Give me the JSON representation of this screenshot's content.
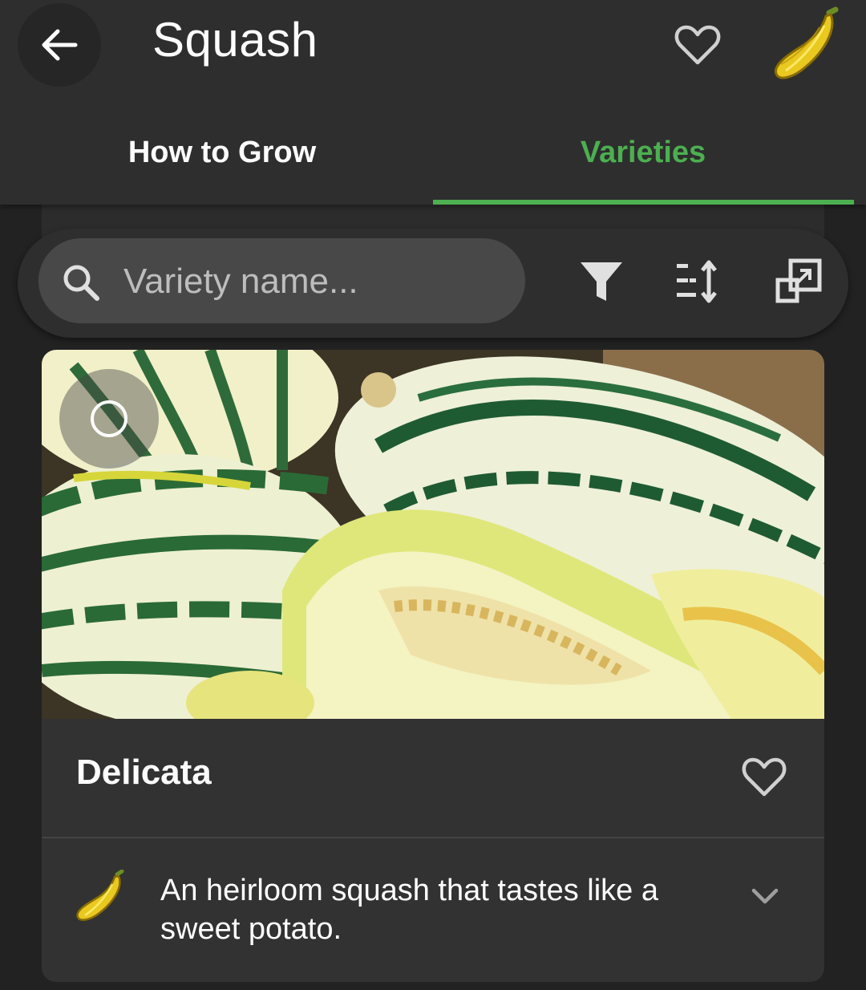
{
  "header": {
    "title": "Squash",
    "back_icon": "arrow-left-icon",
    "favorite_icon": "heart-outline-icon",
    "logo_icon": "squash-icon"
  },
  "tabs": [
    {
      "label": "How to Grow",
      "active": false
    },
    {
      "label": "Varieties",
      "active": true
    }
  ],
  "colors": {
    "accent": "#4caf50",
    "background": "#222222",
    "surface": "#2e2e2e",
    "card": "#323232",
    "search_bg": "#484848"
  },
  "toolbar": {
    "search_placeholder": "Variety name...",
    "search_value": "",
    "icons": [
      "filter-icon",
      "sort-icon",
      "compact-view-icon"
    ]
  },
  "varieties": [
    {
      "name": "Delicata",
      "description": "An heirloom squash that tastes like a sweet potato.",
      "favorite": false,
      "selected": false,
      "expand_icon": "chevron-down-icon",
      "type_icon": "squash-icon"
    }
  ]
}
